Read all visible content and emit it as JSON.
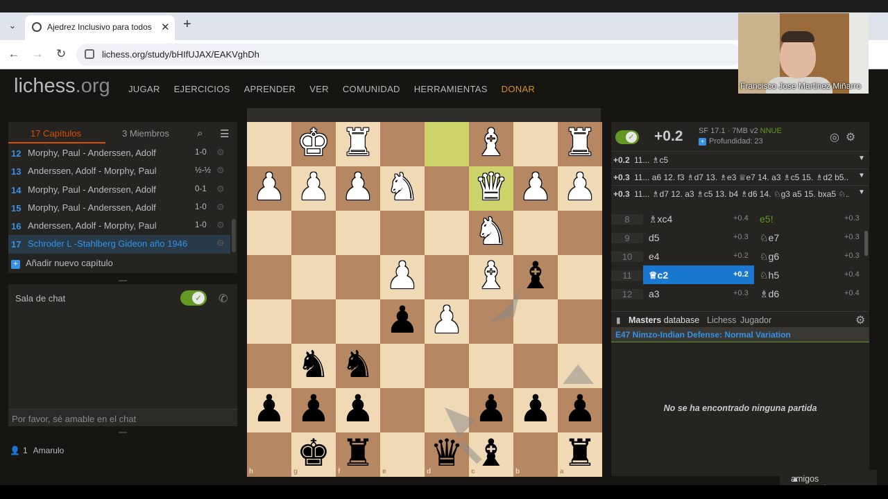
{
  "browser": {
    "tab_title": "Ajedrez Inclusivo para todos (A",
    "url": "lichess.org/study/bHIfUJAX/EAKVghDh"
  },
  "site": {
    "logo": "lichess",
    "logo_tld": ".org",
    "nav": [
      "JUGAR",
      "EJERCICIOS",
      "APRENDER",
      "VER",
      "COMUNIDAD",
      "HERRAMIENTAS",
      "DONAR"
    ]
  },
  "study": {
    "tab_chapters": "17 Capítulos",
    "tab_members": "3 Miembros",
    "chapters": [
      {
        "num": "12",
        "name": "Morphy, Paul - Anderssen, Adolf",
        "result": "1-0"
      },
      {
        "num": "13",
        "name": "Anderssen, Adolf - Morphy, Paul",
        "result": "½-½"
      },
      {
        "num": "14",
        "name": "Morphy, Paul - Anderssen, Adolf",
        "result": "0-1"
      },
      {
        "num": "15",
        "name": "Morphy, Paul - Anderssen, Adolf",
        "result": "1-0"
      },
      {
        "num": "16",
        "name": "Anderssen, Adolf - Morphy, Paul",
        "result": "1-0"
      },
      {
        "num": "17",
        "name": "Schroder L -Stahlberg Gideon año 1946",
        "result": ""
      }
    ],
    "add_chapter": "Añadir nuevo capítulo"
  },
  "chat": {
    "title": "Sala de chat",
    "placeholder": "Por favor, sé amable en el chat"
  },
  "members": {
    "count": "1",
    "user": "Amarulo"
  },
  "board": {
    "ranks": [
      "1",
      "2",
      "3",
      "4",
      "5",
      "6",
      "7",
      "8"
    ],
    "files": [
      "h",
      "g",
      "f",
      "e",
      "d",
      "c",
      "b",
      "a"
    ],
    "highlight_squares": [
      "d1",
      "c2"
    ],
    "pieces": [
      {
        "sq": "g1",
        "glyph": "♚",
        "color": "w"
      },
      {
        "sq": "f1",
        "glyph": "♜",
        "color": "w"
      },
      {
        "sq": "c1",
        "glyph": "♝",
        "color": "w"
      },
      {
        "sq": "a1",
        "glyph": "♜",
        "color": "w"
      },
      {
        "sq": "h2",
        "glyph": "♟",
        "color": "w"
      },
      {
        "sq": "g2",
        "glyph": "♟",
        "color": "w"
      },
      {
        "sq": "f2",
        "glyph": "♟",
        "color": "w"
      },
      {
        "sq": "e2",
        "glyph": "♞",
        "color": "w"
      },
      {
        "sq": "c2",
        "glyph": "♛",
        "color": "w"
      },
      {
        "sq": "b2",
        "glyph": "♟",
        "color": "w"
      },
      {
        "sq": "a2",
        "glyph": "♟",
        "color": "w"
      },
      {
        "sq": "c3",
        "glyph": "♞",
        "color": "w"
      },
      {
        "sq": "e4",
        "glyph": "♟",
        "color": "w"
      },
      {
        "sq": "c4",
        "glyph": "♝",
        "color": "w"
      },
      {
        "sq": "b4",
        "glyph": "♝",
        "color": "b"
      },
      {
        "sq": "e5",
        "glyph": "♟",
        "color": "b"
      },
      {
        "sq": "d5",
        "glyph": "♟",
        "color": "w"
      },
      {
        "sq": "g6",
        "glyph": "♞",
        "color": "b"
      },
      {
        "sq": "f6",
        "glyph": "♞",
        "color": "b"
      },
      {
        "sq": "h7",
        "glyph": "♟",
        "color": "b"
      },
      {
        "sq": "g7",
        "glyph": "♟",
        "color": "b"
      },
      {
        "sq": "f7",
        "glyph": "♟",
        "color": "b"
      },
      {
        "sq": "c7",
        "glyph": "♟",
        "color": "b"
      },
      {
        "sq": "b7",
        "glyph": "♟",
        "color": "b"
      },
      {
        "sq": "a7",
        "glyph": "♟",
        "color": "b"
      },
      {
        "sq": "g8",
        "glyph": "♚",
        "color": "b"
      },
      {
        "sq": "f8",
        "glyph": "♜",
        "color": "b"
      },
      {
        "sq": "d8",
        "glyph": "♛",
        "color": "b"
      },
      {
        "sq": "c8",
        "glyph": "♝",
        "color": "b"
      },
      {
        "sq": "a8",
        "glyph": "♜",
        "color": "b"
      }
    ]
  },
  "ceval": {
    "eval": "+0.2",
    "engine": "SF 17.1 · 7MB v2",
    "nnue": "NNUE",
    "depth": "Profundidad: 23",
    "pvs": [
      {
        "eval": "+0.2",
        "line": "11... ♗c5"
      },
      {
        "eval": "+0.3",
        "line": "11... a6 12. f3 ♗d7 13. ♗e3 ♕e7 14. a3 ♗c5 15. ♗d2 b5..."
      },
      {
        "eval": "+0.3",
        "line": "11... ♗d7 12. a3 ♗c5 13. b4 ♗d6 14. ♘g3 a5 15. bxa5 ♘..."
      }
    ]
  },
  "moves": [
    {
      "n": "8",
      "w": "♗xc4",
      "we": "+0.4",
      "b": "e5!",
      "be": "+0.3",
      "bgood": true
    },
    {
      "n": "9",
      "w": "d5",
      "we": "+0.3",
      "b": "♘e7",
      "be": "+0.3"
    },
    {
      "n": "10",
      "w": "e4",
      "we": "+0.2",
      "b": "♘g6",
      "be": "+0.3"
    },
    {
      "n": "11",
      "w": "♕c2",
      "we": "+0.2",
      "b": "♘h5",
      "be": "+0.4",
      "wactive": true
    },
    {
      "n": "12",
      "w": "a3",
      "we": "+0.3",
      "b": "♗d6",
      "be": "+0.4"
    }
  ],
  "explorer": {
    "tab_masters": "Masters",
    "tab_masters_suffix": " database",
    "tab_lichess": "Lichess",
    "tab_player": "Jugador",
    "opening": "E47 Nimzo-Indian Defense: Normal Variation",
    "empty": "No se ha encontrado ninguna partida"
  },
  "friends": "amigos conectados",
  "webcam_name": "Francisco Jose Martinez Miñarro",
  "colors": {
    "accent": "#3692e7",
    "orange": "#d85000",
    "green": "#629924",
    "light_square": "#f0d9b5",
    "dark_square": "#b58863"
  }
}
